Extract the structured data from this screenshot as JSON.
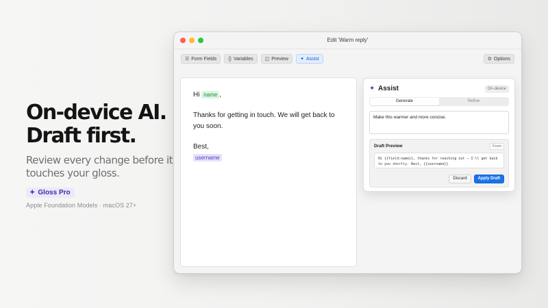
{
  "hero": {
    "title_line1": "On-device AI.",
    "title_line2": "Draft first.",
    "subtitle": "Review every change before it touches your gloss.",
    "badge_icon": "sparkle-icon",
    "badge_label": "Gloss Pro",
    "footnote": "Apple Foundation Models · macOS 27+"
  },
  "window": {
    "title": "Edit 'Warm reply'"
  },
  "toolbar": {
    "form_fields_label": "Form Fields",
    "variables_label": "Variables",
    "preview_label": "Preview",
    "assist_label": "Assist",
    "options_label": "Options",
    "form_fields_icon": "list-icon",
    "variables_icon": "braces-icon",
    "preview_icon": "preview-icon",
    "assist_icon": "sparkle-icon",
    "options_icon": "gear-icon"
  },
  "editor": {
    "greeting": "Hi",
    "name_token": "name",
    "comma": ",",
    "body": "Thanks for getting in touch. We will get back to you soon.",
    "signoff": "Best,",
    "username_token": "username"
  },
  "assist": {
    "title": "Assist",
    "badge": "On-device",
    "tabs": [
      {
        "label": "Generate",
        "active": true
      },
      {
        "label": "Refine",
        "active": false
      }
    ],
    "prompt_value": "Make this warmer and more concise.",
    "draft": {
      "title": "Draft Preview",
      "badge": "Form",
      "text": "Hi {{field:name}}, thanks for reaching out — I'll get back to you shortly. Best, {{username}}",
      "discard_label": "Discard",
      "apply_label": "Apply Draft"
    }
  },
  "colors": {
    "accent": "#1a73e8",
    "pro_purple": "#4b3cc4",
    "token_green": "#1f8a3e"
  }
}
